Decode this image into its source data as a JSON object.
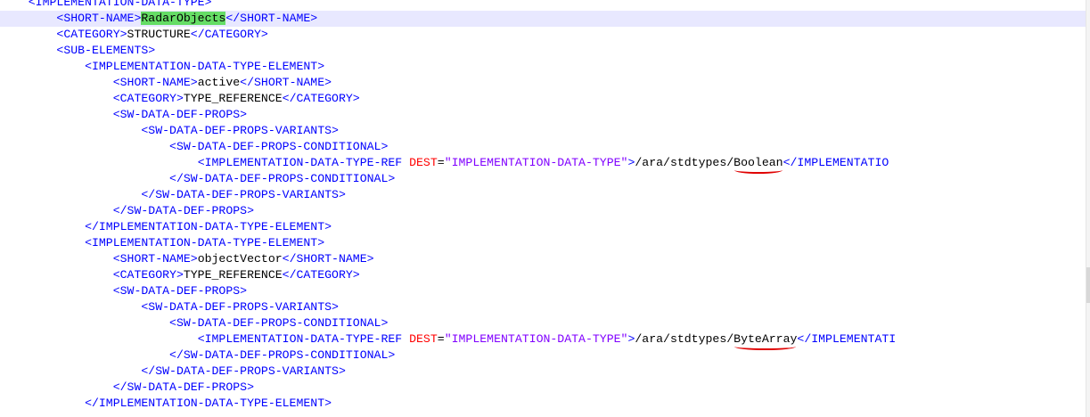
{
  "editor": {
    "lines": [
      {
        "indent": "   ",
        "tokens": [
          {
            "t": "tag",
            "v": "<IMPLEMENTATION-DATA-TYPE>"
          }
        ],
        "faded": true
      },
      {
        "indent": "       ",
        "current": true,
        "tokens": [
          {
            "t": "tag",
            "v": "<SHORT-NAME>"
          },
          {
            "t": "text",
            "v": "RadarObjects",
            "hl": true
          },
          {
            "t": "tag",
            "v": "</SHORT-NAME>"
          }
        ]
      },
      {
        "indent": "       ",
        "tokens": [
          {
            "t": "tag",
            "v": "<CATEGORY>"
          },
          {
            "t": "text",
            "v": "STRUCTURE"
          },
          {
            "t": "tag",
            "v": "</CATEGORY>"
          }
        ]
      },
      {
        "indent": "       ",
        "tokens": [
          {
            "t": "tag",
            "v": "<SUB-ELEMENTS>"
          }
        ]
      },
      {
        "indent": "           ",
        "tokens": [
          {
            "t": "tag",
            "v": "<IMPLEMENTATION-DATA-TYPE-ELEMENT>"
          }
        ]
      },
      {
        "indent": "               ",
        "tokens": [
          {
            "t": "tag",
            "v": "<SHORT-NAME>"
          },
          {
            "t": "text",
            "v": "active"
          },
          {
            "t": "tag",
            "v": "</SHORT-NAME>"
          }
        ]
      },
      {
        "indent": "               ",
        "tokens": [
          {
            "t": "tag",
            "v": "<CATEGORY>"
          },
          {
            "t": "text",
            "v": "TYPE_REFERENCE"
          },
          {
            "t": "tag",
            "v": "</CATEGORY>"
          }
        ]
      },
      {
        "indent": "               ",
        "tokens": [
          {
            "t": "tag",
            "v": "<SW-DATA-DEF-PROPS>"
          }
        ]
      },
      {
        "indent": "                   ",
        "tokens": [
          {
            "t": "tag",
            "v": "<SW-DATA-DEF-PROPS-VARIANTS>"
          }
        ]
      },
      {
        "indent": "                       ",
        "tokens": [
          {
            "t": "tag",
            "v": "<SW-DATA-DEF-PROPS-CONDITIONAL>"
          }
        ]
      },
      {
        "indent": "                           ",
        "tokens": [
          {
            "t": "tag",
            "v": "<IMPLEMENTATION-DATA-TYPE-REF "
          },
          {
            "t": "attr",
            "v": "DEST"
          },
          {
            "t": "eq",
            "v": "="
          },
          {
            "t": "val",
            "v": "\"IMPLEMENTATION-DATA-TYPE\""
          },
          {
            "t": "tag",
            "v": ">"
          },
          {
            "t": "text",
            "v": "/ara/stdtypes/"
          },
          {
            "t": "text",
            "v": "Boolean",
            "mark": true
          },
          {
            "t": "tag",
            "v": "</IMPLEMENTATIO"
          }
        ]
      },
      {
        "indent": "                       ",
        "tokens": [
          {
            "t": "tag",
            "v": "</SW-DATA-DEF-PROPS-CONDITIONAL>"
          }
        ]
      },
      {
        "indent": "                   ",
        "tokens": [
          {
            "t": "tag",
            "v": "</SW-DATA-DEF-PROPS-VARIANTS>"
          }
        ]
      },
      {
        "indent": "               ",
        "tokens": [
          {
            "t": "tag",
            "v": "</SW-DATA-DEF-PROPS>"
          }
        ]
      },
      {
        "indent": "           ",
        "tokens": [
          {
            "t": "tag",
            "v": "</IMPLEMENTATION-DATA-TYPE-ELEMENT>"
          }
        ]
      },
      {
        "indent": "           ",
        "tokens": [
          {
            "t": "tag",
            "v": "<IMPLEMENTATION-DATA-TYPE-ELEMENT>"
          }
        ]
      },
      {
        "indent": "               ",
        "tokens": [
          {
            "t": "tag",
            "v": "<SHORT-NAME>"
          },
          {
            "t": "text",
            "v": "objectVector"
          },
          {
            "t": "tag",
            "v": "</SHORT-NAME>"
          }
        ]
      },
      {
        "indent": "               ",
        "tokens": [
          {
            "t": "tag",
            "v": "<CATEGORY>"
          },
          {
            "t": "text",
            "v": "TYPE_REFERENCE"
          },
          {
            "t": "tag",
            "v": "</CATEGORY>"
          }
        ]
      },
      {
        "indent": "               ",
        "tokens": [
          {
            "t": "tag",
            "v": "<SW-DATA-DEF-PROPS>"
          }
        ]
      },
      {
        "indent": "                   ",
        "tokens": [
          {
            "t": "tag",
            "v": "<SW-DATA-DEF-PROPS-VARIANTS>"
          }
        ]
      },
      {
        "indent": "                       ",
        "tokens": [
          {
            "t": "tag",
            "v": "<SW-DATA-DEF-PROPS-CONDITIONAL>"
          }
        ]
      },
      {
        "indent": "                           ",
        "tokens": [
          {
            "t": "tag",
            "v": "<IMPLEMENTATION-DATA-TYPE-REF "
          },
          {
            "t": "attr",
            "v": "DEST"
          },
          {
            "t": "eq",
            "v": "="
          },
          {
            "t": "val",
            "v": "\"IMPLEMENTATION-DATA-TYPE\""
          },
          {
            "t": "tag",
            "v": ">"
          },
          {
            "t": "text",
            "v": "/ara/stdtypes/"
          },
          {
            "t": "text",
            "v": "ByteArray",
            "mark": true
          },
          {
            "t": "tag",
            "v": "</IMPLEMENTATI"
          }
        ]
      },
      {
        "indent": "                       ",
        "tokens": [
          {
            "t": "tag",
            "v": "</SW-DATA-DEF-PROPS-CONDITIONAL>"
          }
        ]
      },
      {
        "indent": "                   ",
        "tokens": [
          {
            "t": "tag",
            "v": "</SW-DATA-DEF-PROPS-VARIANTS>"
          }
        ]
      },
      {
        "indent": "               ",
        "tokens": [
          {
            "t": "tag",
            "v": "</SW-DATA-DEF-PROPS>"
          }
        ]
      },
      {
        "indent": "           ",
        "tokens": [
          {
            "t": "tag",
            "v": "</IMPLEMENTATION-DATA-TYPE-ELEMENT>"
          }
        ]
      }
    ]
  },
  "colors": {
    "tag": "#0000ff",
    "attribute": "#ff0000",
    "attribute_value": "#8000ff",
    "text": "#000000",
    "current_line": "#e8e8ff",
    "match_highlight": "#66dd66",
    "annotation": "#e00000"
  }
}
